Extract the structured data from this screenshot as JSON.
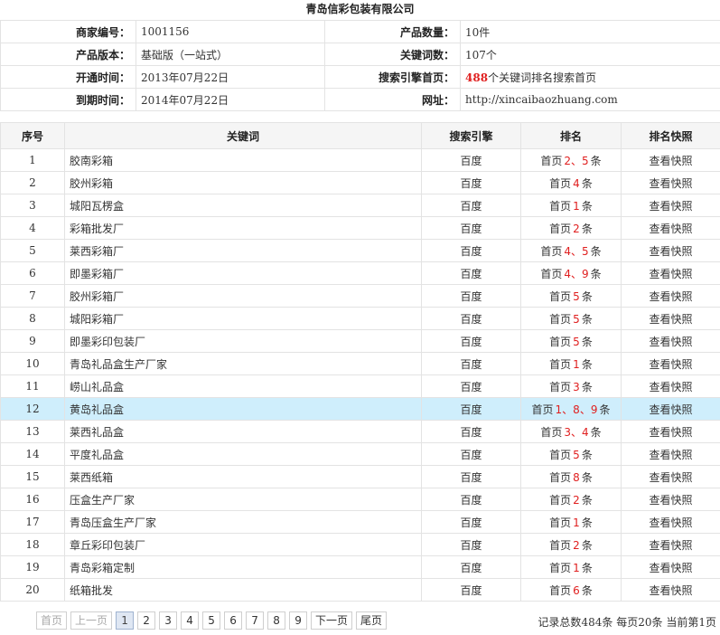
{
  "title": "青岛信彩包装有限公司",
  "info": {
    "merchant_id_label": "商家编号：",
    "merchant_id": "1001156",
    "product_count_label": "产品数量：",
    "product_count": "10件",
    "edition_label": "产品版本：",
    "edition": "基础版（一站式）",
    "keyword_count_label": "关键词数：",
    "keyword_count": "107个",
    "open_date_label": "开通时间：",
    "open_date": "2013年07月22日",
    "search_home_label": "搜索引擎首页：",
    "search_home_count": "488",
    "search_home_text": "个关键词排名搜索首页",
    "expire_date_label": "到期时间：",
    "expire_date": "2014年07月22日",
    "website_label": "网址：",
    "website": "http://xincaibaozhuang.com"
  },
  "table": {
    "headers": {
      "no": "序号",
      "keyword": "关键词",
      "engine": "搜索引擎",
      "rank": "排名",
      "snapshot": "排名快照"
    },
    "rows": [
      {
        "no": "1",
        "keyword": "胶南彩箱",
        "engine": "百度",
        "rank_prefix": "首页",
        "rank": "2、5",
        "rank_suffix": "条",
        "snapshot": "查看快照"
      },
      {
        "no": "2",
        "keyword": "胶州彩箱",
        "engine": "百度",
        "rank_prefix": "首页",
        "rank": "4",
        "rank_suffix": "条",
        "snapshot": "查看快照"
      },
      {
        "no": "3",
        "keyword": "城阳瓦楞盒",
        "engine": "百度",
        "rank_prefix": "首页",
        "rank": "1",
        "rank_suffix": "条",
        "snapshot": "查看快照"
      },
      {
        "no": "4",
        "keyword": "彩箱批发厂",
        "engine": "百度",
        "rank_prefix": "首页",
        "rank": "2",
        "rank_suffix": "条",
        "snapshot": "查看快照"
      },
      {
        "no": "5",
        "keyword": "莱西彩箱厂",
        "engine": "百度",
        "rank_prefix": "首页",
        "rank": "4、5",
        "rank_suffix": "条",
        "snapshot": "查看快照"
      },
      {
        "no": "6",
        "keyword": "即墨彩箱厂",
        "engine": "百度",
        "rank_prefix": "首页",
        "rank": "4、9",
        "rank_suffix": "条",
        "snapshot": "查看快照"
      },
      {
        "no": "7",
        "keyword": "胶州彩箱厂",
        "engine": "百度",
        "rank_prefix": "首页",
        "rank": "5",
        "rank_suffix": "条",
        "snapshot": "查看快照"
      },
      {
        "no": "8",
        "keyword": "城阳彩箱厂",
        "engine": "百度",
        "rank_prefix": "首页",
        "rank": "5",
        "rank_suffix": "条",
        "snapshot": "查看快照"
      },
      {
        "no": "9",
        "keyword": "即墨彩印包装厂",
        "engine": "百度",
        "rank_prefix": "首页",
        "rank": "5",
        "rank_suffix": "条",
        "snapshot": "查看快照"
      },
      {
        "no": "10",
        "keyword": "青岛礼品盒生产厂家",
        "engine": "百度",
        "rank_prefix": "首页",
        "rank": "1",
        "rank_suffix": "条",
        "snapshot": "查看快照"
      },
      {
        "no": "11",
        "keyword": "崂山礼品盒",
        "engine": "百度",
        "rank_prefix": "首页",
        "rank": "3",
        "rank_suffix": "条",
        "snapshot": "查看快照"
      },
      {
        "no": "12",
        "keyword": "黄岛礼品盒",
        "engine": "百度",
        "rank_prefix": "首页",
        "rank": "1、8、9",
        "rank_suffix": "条",
        "snapshot": "查看快照"
      },
      {
        "no": "13",
        "keyword": "莱西礼品盒",
        "engine": "百度",
        "rank_prefix": "首页",
        "rank": "3、4",
        "rank_suffix": "条",
        "snapshot": "查看快照"
      },
      {
        "no": "14",
        "keyword": "平度礼品盒",
        "engine": "百度",
        "rank_prefix": "首页",
        "rank": "5",
        "rank_suffix": "条",
        "snapshot": "查看快照"
      },
      {
        "no": "15",
        "keyword": "莱西纸箱",
        "engine": "百度",
        "rank_prefix": "首页",
        "rank": "8",
        "rank_suffix": "条",
        "snapshot": "查看快照"
      },
      {
        "no": "16",
        "keyword": "压盒生产厂家",
        "engine": "百度",
        "rank_prefix": "首页",
        "rank": "2",
        "rank_suffix": "条",
        "snapshot": "查看快照"
      },
      {
        "no": "17",
        "keyword": "青岛压盒生产厂家",
        "engine": "百度",
        "rank_prefix": "首页",
        "rank": "1",
        "rank_suffix": "条",
        "snapshot": "查看快照"
      },
      {
        "no": "18",
        "keyword": "章丘彩印包装厂",
        "engine": "百度",
        "rank_prefix": "首页",
        "rank": "2",
        "rank_suffix": "条",
        "snapshot": "查看快照"
      },
      {
        "no": "19",
        "keyword": "青岛彩箱定制",
        "engine": "百度",
        "rank_prefix": "首页",
        "rank": "1",
        "rank_suffix": "条",
        "snapshot": "查看快照"
      },
      {
        "no": "20",
        "keyword": "纸箱批发",
        "engine": "百度",
        "rank_prefix": "首页",
        "rank": "6",
        "rank_suffix": "条",
        "snapshot": "查看快照"
      }
    ],
    "highlight_row": 12
  },
  "pager": {
    "first": "首页",
    "prev": "上一页",
    "pages": [
      "1",
      "2",
      "3",
      "4",
      "5",
      "6",
      "7",
      "8",
      "9"
    ],
    "current": "1",
    "next": "下一页",
    "last": "尾页"
  },
  "summary": {
    "total_prefix": "记录总数",
    "total": "484",
    "total_suffix": "条",
    "per_page_prefix": "每页",
    "per_page": "20",
    "per_page_suffix": "条",
    "current_prefix": "当前第",
    "current": "1",
    "current_suffix": "页"
  },
  "colors": {
    "rank_red": "#e02020",
    "highlight_row_bg": "#cfeefc",
    "header_bg": "#f5f5f5"
  }
}
